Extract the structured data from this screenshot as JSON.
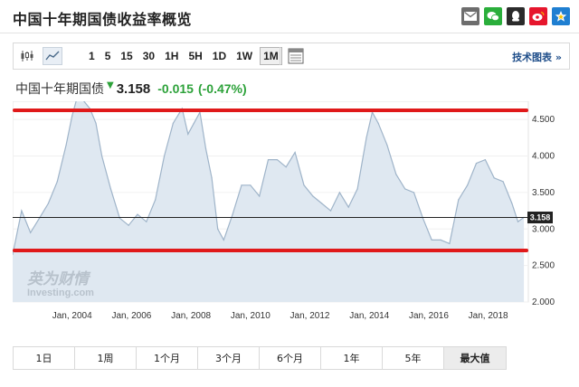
{
  "page": {
    "title": "中国十年期国债收益率概览"
  },
  "share": {
    "icons": [
      "mail-icon",
      "wechat-icon",
      "qq-icon",
      "weibo-icon",
      "qzone-icon"
    ]
  },
  "toolbar": {
    "periods": [
      "1",
      "5",
      "15",
      "30",
      "1H",
      "5H",
      "1D",
      "1W",
      "1M"
    ],
    "active_period": "1M",
    "tech_link": "技术图表 »"
  },
  "quote": {
    "name": "中国十年期国债",
    "price": "3.158",
    "change": "-0.015",
    "change_pct": "(-0.47%)",
    "color_down": "#2da23a"
  },
  "watermark": {
    "brand_cn": "英为财情",
    "brand_en": "Investing.com"
  },
  "chart_data": {
    "type": "area",
    "title": "",
    "xlabel": "",
    "ylabel": "",
    "x_ticks": [
      "Jan, 2004",
      "Jan, 2006",
      "Jan, 2008",
      "Jan, 2010",
      "Jan, 2012",
      "Jan, 2014",
      "Jan, 2016",
      "Jan, 2018"
    ],
    "y_ticks": [
      "4.500",
      "4.000",
      "3.500",
      "3.000",
      "2.500",
      "2.000"
    ],
    "ylim": [
      2.0,
      4.75
    ],
    "current_value_label": "3.158",
    "current_value": 3.158,
    "series": [
      {
        "x": [
          2002.0,
          2002.3,
          2002.6,
          2002.9,
          2003.2,
          2003.5,
          2003.8,
          2004.0,
          2004.2,
          2004.4,
          2004.6,
          2004.8,
          2005.0,
          2005.3,
          2005.6,
          2005.9,
          2006.2,
          2006.5,
          2006.8,
          2007.1,
          2007.4,
          2007.7,
          2007.9,
          2008.1,
          2008.3,
          2008.5,
          2008.7,
          2008.9,
          2009.1,
          2009.4,
          2009.7,
          2010.0,
          2010.3,
          2010.6,
          2010.9,
          2011.2,
          2011.5,
          2011.8,
          2012.1,
          2012.4,
          2012.7,
          2013.0,
          2013.3,
          2013.6,
          2013.9,
          2014.1,
          2014.3,
          2014.6,
          2014.9,
          2015.2,
          2015.5,
          2015.8,
          2016.1,
          2016.4,
          2016.7,
          2017.0,
          2017.3,
          2017.6,
          2017.9,
          2018.2,
          2018.5,
          2018.8,
          2019.0,
          2019.2
        ],
        "y": [
          2.65,
          3.25,
          2.95,
          3.15,
          3.35,
          3.65,
          4.15,
          4.55,
          4.85,
          4.75,
          4.65,
          4.45,
          4.0,
          3.55,
          3.15,
          3.05,
          3.2,
          3.1,
          3.4,
          4.0,
          4.45,
          4.65,
          4.3,
          4.45,
          4.6,
          4.1,
          3.7,
          3.0,
          2.85,
          3.2,
          3.6,
          3.6,
          3.45,
          3.95,
          3.95,
          3.85,
          4.05,
          3.6,
          3.45,
          3.35,
          3.25,
          3.5,
          3.3,
          3.55,
          4.25,
          4.6,
          4.45,
          4.15,
          3.75,
          3.55,
          3.5,
          3.15,
          2.85,
          2.85,
          2.8,
          3.4,
          3.6,
          3.9,
          3.95,
          3.7,
          3.65,
          3.35,
          3.1,
          3.16
        ]
      }
    ]
  }
}
